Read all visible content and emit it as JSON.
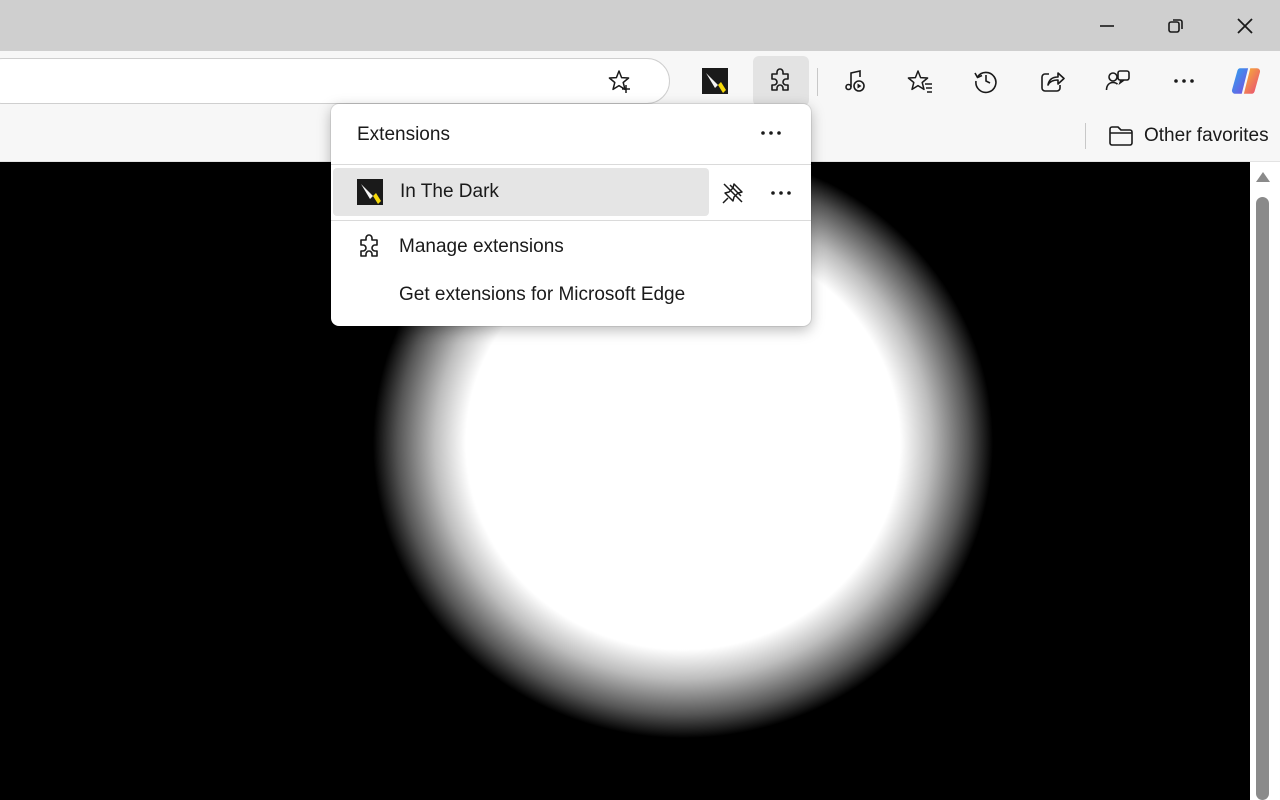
{
  "window": {
    "minimize_icon": "minimize-icon",
    "restore_icon": "restore-icon",
    "close_icon": "close-icon"
  },
  "toolbar": {
    "favorite_star_icon": "star-add-icon",
    "extension_pinned_icon": "flashlight-icon",
    "extensions_icon": "puzzle-icon",
    "buttons": [
      "media-icon",
      "favorites-icon",
      "history-icon",
      "share-icon",
      "feedback-icon",
      "more-icon",
      "copilot-icon"
    ]
  },
  "favorites_bar": {
    "other_favorites": "Other favorites"
  },
  "extensions_popup": {
    "title": "Extensions",
    "extension": {
      "name": "In The Dark"
    },
    "manage": "Manage extensions",
    "get_more": "Get extensions for Microsoft Edge"
  },
  "colors": {
    "titlebar": "#cfcfcf",
    "toolbar": "#f7f7f7",
    "page_background": "#000000",
    "flashlight_accent": "#f5d90a"
  }
}
